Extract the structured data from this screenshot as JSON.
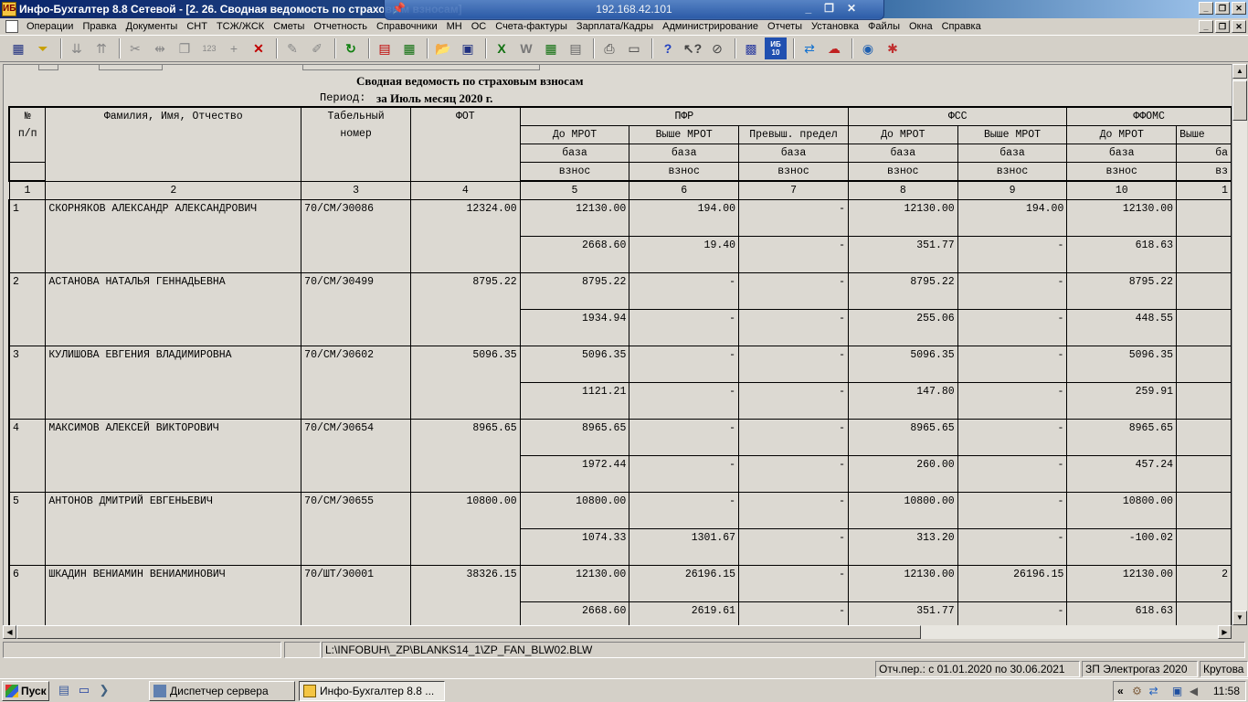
{
  "window": {
    "title": "Инфо-Бухгалтер 8.8 Сетевой - [2. 26. Сводная ведомость по страховым взносам]",
    "rdp_host": "192.168.42.101"
  },
  "menu": [
    "Операции",
    "Правка",
    "Документы",
    "СНТ",
    "ТСЖ/ЖСК",
    "Сметы",
    "Отчетность",
    "Справочники",
    "МН",
    "ОС",
    "Счета-фактуры",
    "Зарплата/Кадры",
    "Администрирование",
    "Отчеты",
    "Установка",
    "Файлы",
    "Окна",
    "Справка"
  ],
  "toolbar_icons": [
    "form-icon",
    "filter-icon",
    "sort-asc-icon",
    "sort-desc-icon",
    "cut-icon",
    "split-icon",
    "copy-icon",
    "number-icon",
    "add-icon",
    "delete-icon",
    "mark-icon",
    "unmark-icon",
    "refresh-icon",
    "pdf-icon",
    "calculator-icon",
    "open-folder-icon",
    "save-icon",
    "excel-icon",
    "word-icon",
    "export-icon",
    "document-icon",
    "print-icon",
    "preview-icon",
    "help-icon",
    "context-help-icon",
    "compass-icon",
    "film-icon",
    "ib10-icon",
    "teamviewer-icon",
    "remote-icon",
    "network-icon",
    "tools-icon"
  ],
  "report": {
    "title": "Сводная ведомость по страховым взносам",
    "period_label": "Период:",
    "period_value": "за Июль месяц 2020 г.",
    "headers": {
      "num_top": "№",
      "num_bottom": "п/п",
      "fio": "Фамилия, Имя, Отчество",
      "tab_top": "Табельный",
      "tab_bottom": "номер",
      "fot": "ФОТ",
      "pfr": "ПФР",
      "fss": "ФСС",
      "ffoms": "ФФОМС",
      "do_mrot": "До МРОТ",
      "vyshe_mrot": "Выше МРОТ",
      "prevysh": "Превыш. предел",
      "baza": "база",
      "vznos": "взнос",
      "vyshe_cut": "Выше",
      "baza_cut": "ба",
      "vznos_cut": "вз"
    },
    "col_numbers": [
      "1",
      "2",
      "3",
      "4",
      "5",
      "6",
      "7",
      "8",
      "9",
      "10",
      "1"
    ],
    "rows": [
      {
        "num": "1",
        "name": "СКОРНЯКОВ АЛЕКСАНДР АЛЕКСАНДРОВИЧ",
        "tab": "70/СМ/Э0086",
        "fot": "12324.00",
        "base": [
          "12130.00",
          "194.00",
          "-",
          "12130.00",
          "194.00",
          "12130.00",
          ""
        ],
        "contrib": [
          "2668.60",
          "19.40",
          "-",
          "351.77",
          "-",
          "618.63",
          ""
        ]
      },
      {
        "num": "2",
        "name": "АСТАНОВА НАТАЛЬЯ ГЕННАДЬЕВНА",
        "tab": "70/СМ/Э0499",
        "fot": "8795.22",
        "base": [
          "8795.22",
          "-",
          "-",
          "8795.22",
          "-",
          "8795.22",
          ""
        ],
        "contrib": [
          "1934.94",
          "-",
          "-",
          "255.06",
          "-",
          "448.55",
          ""
        ]
      },
      {
        "num": "3",
        "name": "КУЛИШОВА ЕВГЕНИЯ ВЛАДИМИРОВНА",
        "tab": "70/СМ/Э0602",
        "fot": "5096.35",
        "base": [
          "5096.35",
          "-",
          "-",
          "5096.35",
          "-",
          "5096.35",
          ""
        ],
        "contrib": [
          "1121.21",
          "-",
          "-",
          "147.80",
          "-",
          "259.91",
          ""
        ]
      },
      {
        "num": "4",
        "name": "МАКСИМОВ АЛЕКСЕЙ ВИКТОРОВИЧ",
        "tab": "70/СМ/Э0654",
        "fot": "8965.65",
        "base": [
          "8965.65",
          "-",
          "-",
          "8965.65",
          "-",
          "8965.65",
          ""
        ],
        "contrib": [
          "1972.44",
          "-",
          "-",
          "260.00",
          "-",
          "457.24",
          ""
        ]
      },
      {
        "num": "5",
        "name": "АНТОНОВ ДМИТРИЙ ЕВГЕНЬЕВИЧ",
        "tab": "70/СМ/Э0655",
        "fot": "10800.00",
        "base": [
          "10800.00",
          "-",
          "-",
          "10800.00",
          "-",
          "10800.00",
          ""
        ],
        "contrib": [
          "1074.33",
          "1301.67",
          "-",
          "313.20",
          "-",
          "-100.02",
          ""
        ]
      },
      {
        "num": "6",
        "name": "ШКАДИН ВЕНИАМИН ВЕНИАМИНОВИЧ",
        "tab": "70/ШТ/Э0001",
        "fot": "38326.15",
        "base": [
          "12130.00",
          "26196.15",
          "-",
          "12130.00",
          "26196.15",
          "12130.00",
          "2"
        ],
        "contrib": [
          "2668.60",
          "2619.61",
          "-",
          "351.77",
          "-",
          "618.63",
          ""
        ]
      }
    ]
  },
  "pathbar": {
    "path": "L:\\INFOBUH\\_ZP\\BLANKS14_1\\ZP_FAN_BLW02.BLW"
  },
  "status": {
    "period": "Отч.пер.: с 01.01.2020 по 30.06.2021",
    "org": "ЗП Электрогаз 2020",
    "user": "Крутова"
  },
  "taskbar": {
    "start": "Пуск",
    "tasks": [
      "Диспетчер сервера",
      "Инфо-Бухгалтер 8.8 ..."
    ],
    "clock": "11:58",
    "tray_expand": "«"
  },
  "colors": {
    "titlebar": "#0a246a",
    "face": "#d4d0c8",
    "report_bg": "#dcd9d2"
  }
}
